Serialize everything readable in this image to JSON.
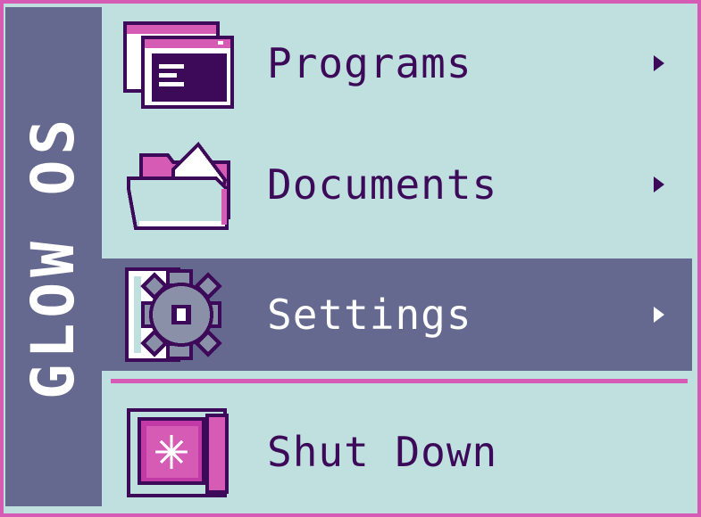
{
  "brand": {
    "title": "GLOW OS"
  },
  "menu": {
    "items": [
      {
        "label": "Programs",
        "icon": "programs-window-icon",
        "has_submenu": true,
        "selected": false
      },
      {
        "label": "Documents",
        "icon": "documents-folder-icon",
        "has_submenu": true,
        "selected": false
      },
      {
        "label": "Settings",
        "icon": "settings-gear-icon",
        "has_submenu": true,
        "selected": true
      },
      {
        "label": "Shut Down",
        "icon": "shutdown-power-icon",
        "has_submenu": false,
        "selected": false
      }
    ]
  },
  "colors": {
    "background": "#bfe0df",
    "sidebar": "#65698f",
    "border_accent": "#d65bb5",
    "text": "#3d0a5a",
    "selected_text": "#ffffff"
  }
}
